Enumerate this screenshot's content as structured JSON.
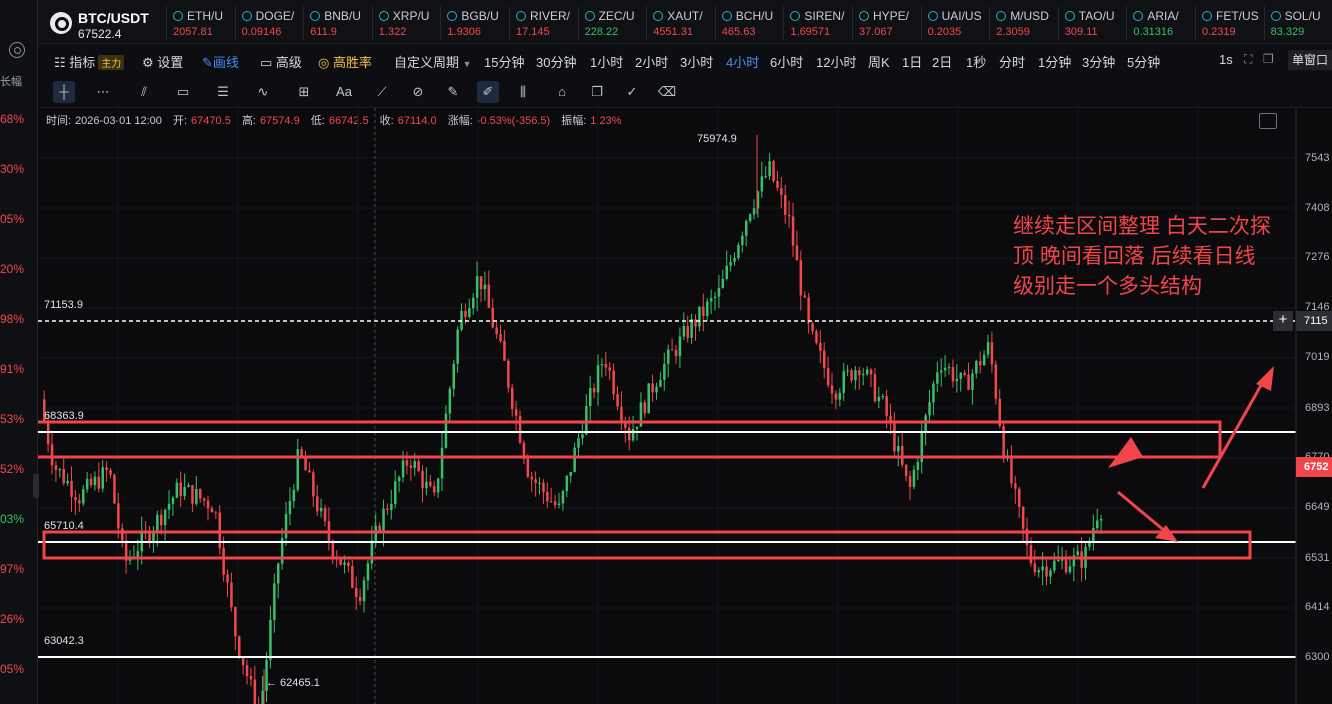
{
  "symbol": {
    "name": "BTC/USDT",
    "price": "67522.4"
  },
  "tickers": [
    {
      "name": "ETH/U",
      "price": "2057.81",
      "dir": "dn"
    },
    {
      "name": "DOGE/",
      "price": "0.09146",
      "dir": "dn"
    },
    {
      "name": "BNB/U",
      "price": "611.9",
      "dir": "dn"
    },
    {
      "name": "XRP/U",
      "price": "1.322",
      "dir": "dn"
    },
    {
      "name": "BGB/U",
      "price": "1.9306",
      "dir": "dn"
    },
    {
      "name": "RIVER/",
      "price": "17.145",
      "dir": "dn"
    },
    {
      "name": "ZEC/U",
      "price": "228.22",
      "dir": "up"
    },
    {
      "name": "XAUT/",
      "price": "4551.31",
      "dir": "dn"
    },
    {
      "name": "BCH/U",
      "price": "465.63",
      "dir": "dn"
    },
    {
      "name": "SIREN/",
      "price": "1.69571",
      "dir": "dn"
    },
    {
      "name": "HYPE/",
      "price": "37.067",
      "dir": "dn"
    },
    {
      "name": "UAI/US",
      "price": "0.2035",
      "dir": "dn"
    },
    {
      "name": "M/USD",
      "price": "2.3059",
      "dir": "dn"
    },
    {
      "name": "TAO/U",
      "price": "309.11",
      "dir": "dn"
    },
    {
      "name": "ARIA/",
      "price": "0.31316",
      "dir": "up"
    },
    {
      "name": "FET/US",
      "price": "0.2319",
      "dir": "dn"
    },
    {
      "name": "SOL/U",
      "price": "83.329",
      "dir": "up"
    }
  ],
  "toolbar": {
    "indicators": "指标",
    "main_badge": "主力",
    "settings": "设置",
    "draw": "画线",
    "advanced": "高级",
    "win_rate": "高胜率",
    "custom_period": "自定义周期",
    "periods": [
      "15分钟",
      "30分钟",
      "1小时",
      "2小时",
      "3小时",
      "4小时",
      "6小时",
      "12小时",
      "周K",
      "1日",
      "2日",
      "1秒",
      "分时",
      "1分钟",
      "3分钟",
      "5分钟"
    ],
    "active_period": "4小时",
    "refresh": "1s",
    "single_window": "单窗口"
  },
  "drawing_tools": [
    "crosshair-icon",
    "dotted-line-icon",
    "parallel-channel-icon",
    "rectangle-icon",
    "fibonacci-icon",
    "wave-icon",
    "measure-icon",
    "text-icon",
    "ruler-icon",
    "brush-icon",
    "pencil-icon",
    "highlighter-icon",
    "compare-icon",
    "lock-icon",
    "copy-icon",
    "edit-icon",
    "trash-icon"
  ],
  "left_column": {
    "label": "长幅",
    "pcts": [
      {
        "text": "68%",
        "color": "dn"
      },
      {
        "text": "30%",
        "color": "dn"
      },
      {
        "text": "05%",
        "color": "dn"
      },
      {
        "text": "20%",
        "color": "dn"
      },
      {
        "text": "98%",
        "color": "dn"
      },
      {
        "text": "91%",
        "color": "dn"
      },
      {
        "text": "53%",
        "color": "dn"
      },
      {
        "text": "52%",
        "color": "dn"
      },
      {
        "text": "03%",
        "color": "up"
      },
      {
        "text": "97%",
        "color": "dn"
      },
      {
        "text": "26%",
        "color": "dn"
      },
      {
        "text": "05%",
        "color": "dn"
      }
    ]
  },
  "ohlc_info": {
    "time_label": "时间:",
    "time": "2026-03-01 12:00",
    "open_label": "开:",
    "open": "67470.5",
    "high_label": "高:",
    "high": "67574.9",
    "low_label": "低:",
    "low": "66742.5",
    "close_label": "收:",
    "close": "67114.0",
    "change_label": "涨幅:",
    "change": "-0.53%(-356.5)",
    "amp_label": "振幅:",
    "amplitude": "1.23%"
  },
  "annotation": {
    "lines": [
      "继续走区间整理  白天二次探",
      "顶  晚间看回落  后续看日线",
      "级别走一个多头结构"
    ]
  },
  "levels": {
    "l1": "71153.9",
    "l2": "68363.9",
    "l3": "65710.4",
    "l4": "63042.3"
  },
  "extremes": {
    "high": "75974.9",
    "low": "← 62465.1"
  },
  "price_axis": [
    "7543",
    "7408",
    "7276",
    "7146",
    "7019",
    "6893",
    "6770",
    "6649",
    "6531",
    "6414",
    "6300"
  ],
  "last_price_tag": "6752",
  "crosshair_tag": "7115",
  "colors": {
    "up": "#36c06a",
    "down": "#f0484c",
    "accent": "#4b8df7",
    "annotation": "#f0454a"
  }
}
